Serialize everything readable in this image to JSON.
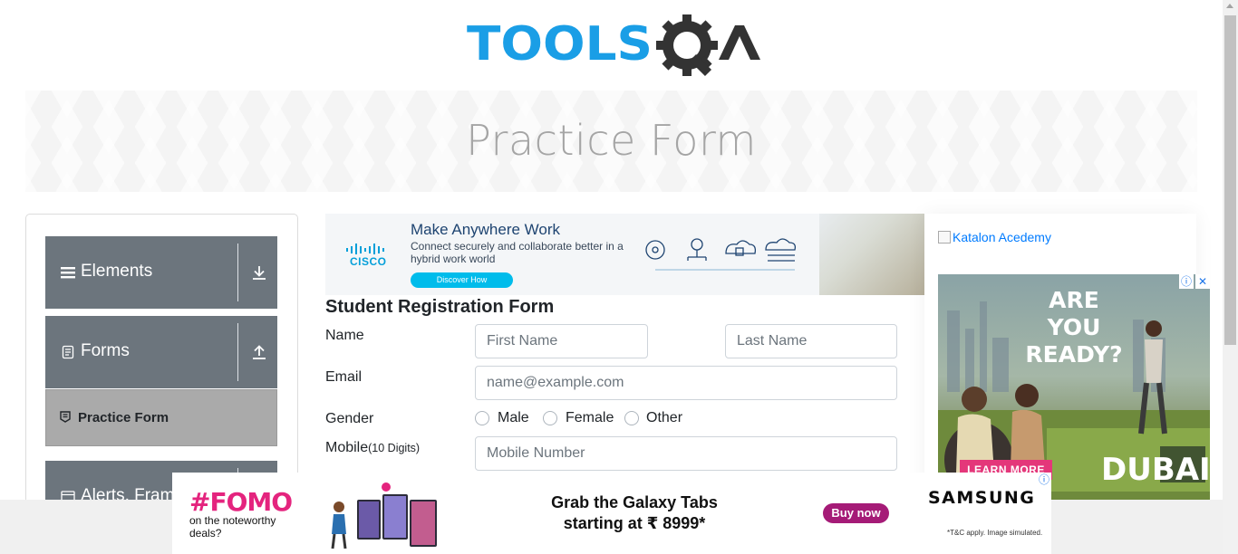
{
  "header": {
    "logo_text": "TOOLSQA",
    "banner_title": "Practice Form"
  },
  "sidebar": {
    "groups": [
      {
        "label": "Elements",
        "icon": "hamburger-icon",
        "arrow": "download-arrow-icon"
      },
      {
        "label": "Forms",
        "icon": "document-icon",
        "arrow": "upload-arrow-icon"
      },
      {
        "label": "Alerts, Frame & Windows",
        "icon": "window-icon",
        "arrow": "download-arrow-icon"
      }
    ],
    "active_item": {
      "label": "Practice Form",
      "icon": "form-icon"
    }
  },
  "cisco_ad": {
    "brand": "CISCO",
    "headline": "Make Anywhere Work",
    "subtext": "Connect securely and collaborate better in a hybrid work world",
    "cta": "Discover How"
  },
  "form": {
    "title": "Student Registration Form",
    "name_label": "Name",
    "first_name_placeholder": "First Name",
    "last_name_placeholder": "Last Name",
    "email_label": "Email",
    "email_placeholder": "name@example.com",
    "gender_label": "Gender",
    "gender_options": [
      "Male",
      "Female",
      "Other"
    ],
    "mobile_label": "Mobile",
    "mobile_hint": "(10 Digits)",
    "mobile_placeholder": "Mobile Number"
  },
  "right_ads": {
    "katalon_alt": "Katalon Acedemy",
    "dubai_headline": "ARE YOU READY?",
    "dubai_cta": "LEARN MORE",
    "dubai_brand": "DUBAI",
    "close_symbol": "✕",
    "info_symbol": "ⓘ"
  },
  "bottom_ad": {
    "fomo_title": "#FOMO",
    "fomo_sub": "on the noteworthy deals?",
    "headline_line1": "Grab the Galaxy Tabs",
    "headline_line2": "starting at ₹ 8999*",
    "cta": "Buy now",
    "brand": "SAMSUNG",
    "disclaimer": "*T&C apply. Image simulated."
  },
  "colors": {
    "brand_blue": "#1a9ee6",
    "brand_dark": "#333333",
    "sidebar_group": "#6c757d",
    "active_item": "#aaaaaa",
    "cisco_blue": "#049fd9",
    "samsung_purple": "#a51b77",
    "fomo_pink": "#e4247e"
  }
}
